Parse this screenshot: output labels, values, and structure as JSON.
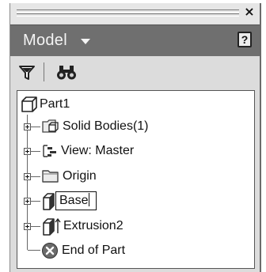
{
  "panel": {
    "close_glyph": "×",
    "title": "Model",
    "help_glyph": "?"
  },
  "toolbar": {
    "filter_icon": "filter-icon",
    "find_icon": "binoculars-icon"
  },
  "tree": {
    "root": {
      "label": "Part1",
      "icon": "part-icon"
    },
    "items": [
      {
        "label": "Solid Bodies(1)",
        "icon": "solid-bodies-icon",
        "expandable": true
      },
      {
        "label": "View: Master",
        "icon": "view-icon",
        "expandable": true
      },
      {
        "label": "Origin",
        "icon": "folder-icon",
        "expandable": true
      },
      {
        "label": "Base",
        "icon": "extrusion-icon",
        "expandable": true,
        "editing": true
      },
      {
        "label": "Extrusion2",
        "icon": "extrusion-icon",
        "expandable": true
      },
      {
        "label": "End of Part",
        "icon": "end-of-part-icon",
        "expandable": false
      }
    ]
  },
  "colors": {
    "header_bg": "#6f6f6f",
    "panel_bg": "#dcdcdc",
    "tree_bg": "#ffffff"
  }
}
